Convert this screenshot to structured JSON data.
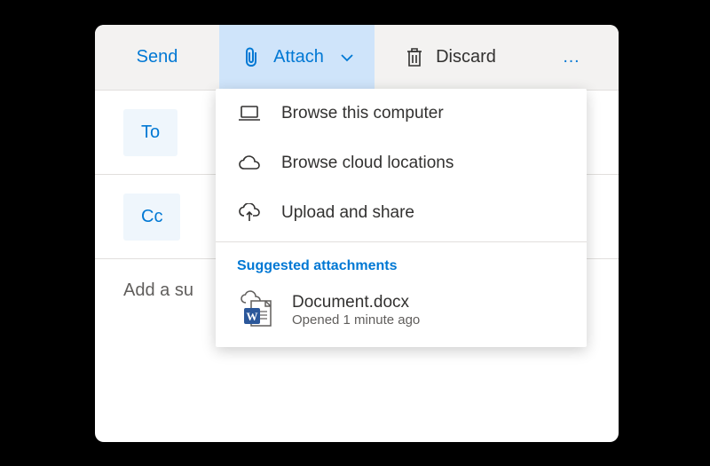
{
  "toolbar": {
    "send_label": "Send",
    "attach_label": "Attach",
    "discard_label": "Discard",
    "more_label": "…"
  },
  "fields": {
    "to_label": "To",
    "cc_label": "Cc",
    "subject_placeholder": "Add a su"
  },
  "attach_menu": {
    "browse_computer": "Browse this computer",
    "browse_cloud": "Browse cloud locations",
    "upload_share": "Upload and share",
    "suggested_label": "Suggested attachments",
    "suggested": [
      {
        "name": "Document.docx",
        "meta": "Opened 1 minute ago"
      }
    ]
  }
}
